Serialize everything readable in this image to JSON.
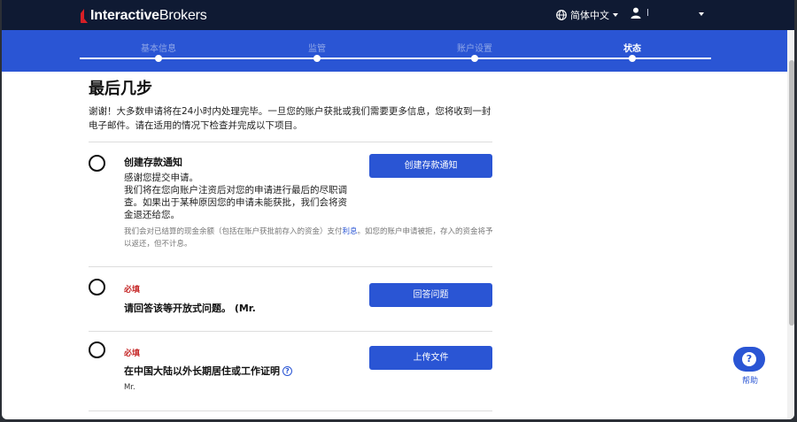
{
  "header": {
    "brand_bold": "Interactive",
    "brand_rest": "Brokers",
    "language": "简体中文",
    "user_name": "l"
  },
  "stepper": {
    "steps": [
      {
        "label": "基本信息",
        "active": false
      },
      {
        "label": "监管",
        "active": false
      },
      {
        "label": "账户设置",
        "active": false
      },
      {
        "label": "状态",
        "active": true
      }
    ]
  },
  "main": {
    "title": "最后几步",
    "intro": "谢谢！大多数申请将在24小时内处理完毕。一旦您的账户获批或我们需要更多信息，您将收到一封电子邮件。请在适用的情况下检查并完成以下项目。",
    "tasks": [
      {
        "title": "创建存款通知",
        "body": "感谢您提交申请。\n我们将在您向账户注资后对您的申请进行最后的尽职调查。如果出于某种原因您的申请未能获批，我们会将资金退还给您。",
        "note_before": "我们会对已结算的现金余额（包括在账户获批前存入的资金）支付",
        "note_link": "利息",
        "note_after": "。如您的账户申请被拒，存入的资金将予以返还，但不计息。",
        "button": "创建存款通知"
      },
      {
        "required": "必填",
        "title": "请回答该等开放式问题。 (Mr.",
        "button": "回答问题"
      },
      {
        "required": "必填",
        "title": "在中国大陆以外长期居住或工作证明",
        "help_glyph": "?",
        "sub": "Mr.",
        "button": "上传文件"
      }
    ]
  },
  "help": {
    "glyph": "?",
    "label": "帮助"
  },
  "colors": {
    "primary": "#2a55d4",
    "topbar": "#0f1a33",
    "required": "#c62828"
  }
}
